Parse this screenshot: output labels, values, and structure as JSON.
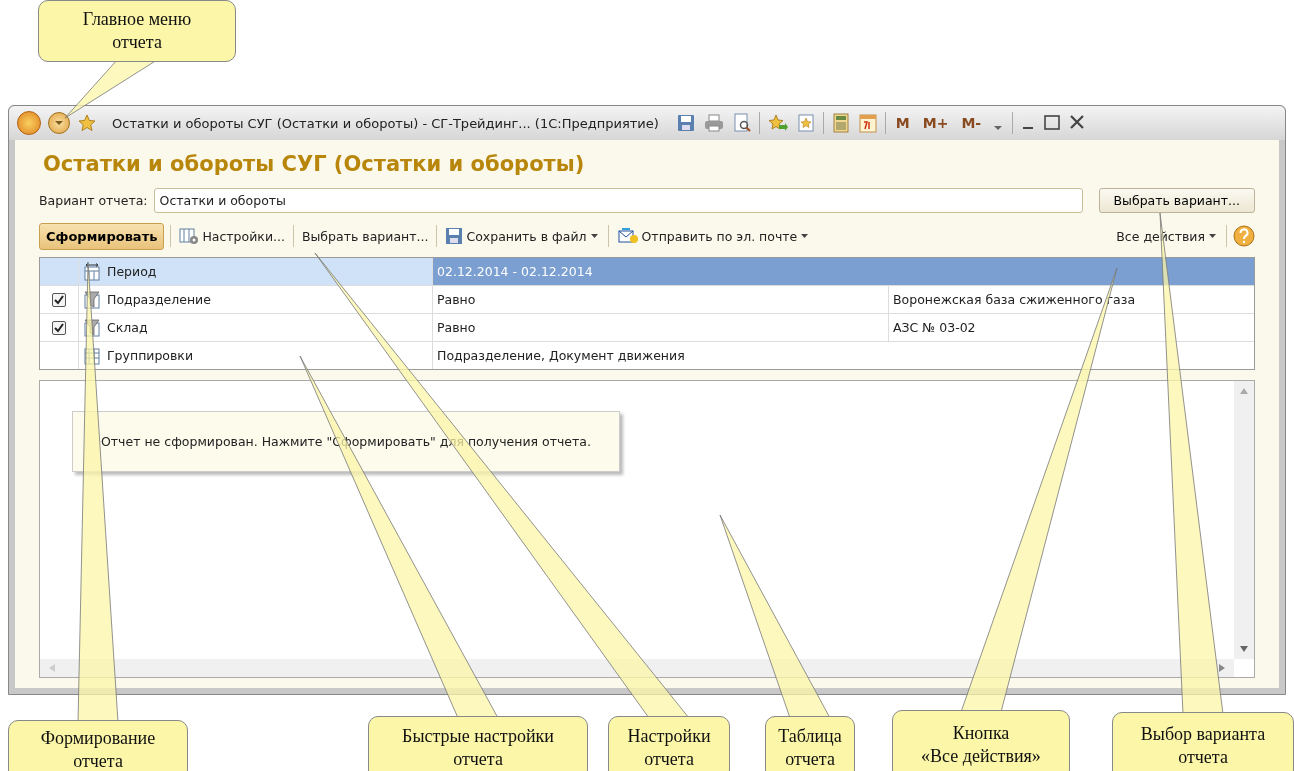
{
  "window": {
    "title": "Остатки и обороты СУГ (Остатки и обороты) - СГ-Трейдинг...  (1С:Предприятие)",
    "memory_buttons": [
      "M",
      "M+",
      "M-"
    ]
  },
  "form": {
    "title": "Остатки и обороты СУГ (Остатки и обороты)",
    "variant": {
      "label": "Вариант отчета:",
      "value": "Остатки и обороты"
    },
    "choose_button": "Выбрать вариант..."
  },
  "toolbar": {
    "items": [
      {
        "kind": "primary",
        "label": "Сформировать"
      },
      {
        "kind": "settings",
        "label": "Настройки..."
      },
      {
        "kind": "plain",
        "label": "Выбрать вариант..."
      },
      {
        "kind": "save",
        "label": "Сохранить в файл",
        "dropdown": true
      },
      {
        "kind": "mail",
        "label": "Отправить по эл. почте",
        "dropdown": true
      }
    ],
    "all_actions": "Все действия"
  },
  "settings": [
    {
      "kind": "period",
      "name": "Период",
      "selected": true,
      "condition": "02.12.2014 - 02.12.2014"
    },
    {
      "kind": "filter",
      "name": "Подразделение",
      "selected": false,
      "checked": true,
      "condition": "Равно",
      "value": "Воронежская база сжиженного газа"
    },
    {
      "kind": "filter",
      "name": "Склад",
      "selected": false,
      "checked": true,
      "condition": "Равно",
      "value": "АЗС № 03-02"
    },
    {
      "kind": "grouping",
      "name": "Группировки",
      "selected": false,
      "condition": "Подразделение, Документ движения"
    }
  ],
  "report": {
    "message": "Отчет не сформирован. Нажмите \"Сформировать\" для получения отчета."
  },
  "callouts": [
    {
      "lines": [
        "Главное меню",
        "отчета"
      ]
    },
    {
      "lines": [
        "Формирование",
        "отчета"
      ]
    },
    {
      "lines": [
        "Быстрые настройки",
        "отчета"
      ]
    },
    {
      "lines": [
        "Настройки",
        "отчета"
      ]
    },
    {
      "lines": [
        "Таблица",
        "отчета"
      ]
    },
    {
      "lines": [
        "Кнопка",
        "«Все действия»"
      ]
    },
    {
      "lines": [
        "Выбор варианта",
        "отчета"
      ]
    }
  ]
}
